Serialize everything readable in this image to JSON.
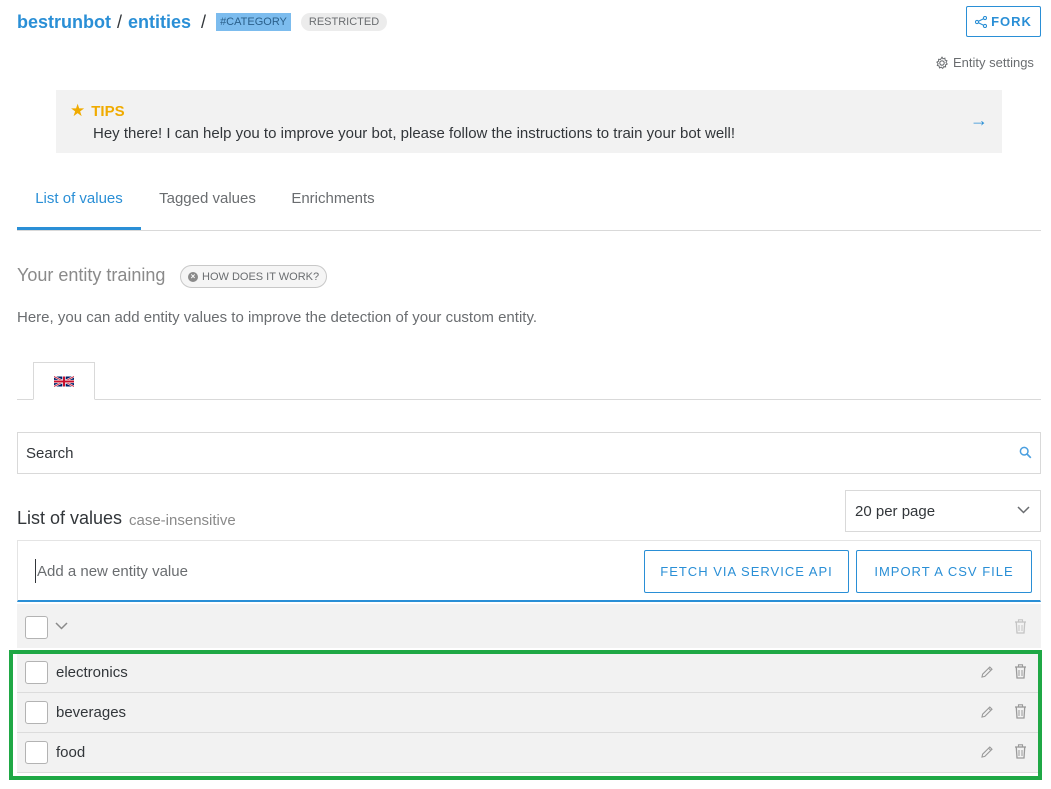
{
  "breadcrumb": {
    "bot": "bestrunbot",
    "separator": "/",
    "section": "entities",
    "separator2": "/",
    "category_tag": "#CATEGORY",
    "restricted_tag": "RESTRICTED"
  },
  "header": {
    "fork_label": "FORK",
    "entity_settings_label": "Entity settings"
  },
  "tips": {
    "title": "TIPS",
    "text": "Hey there! I can help you to improve your bot, please follow the instructions to train your bot well!",
    "arrow": "→"
  },
  "tabs": [
    {
      "label": "List of values",
      "active": true
    },
    {
      "label": "Tagged values",
      "active": false
    },
    {
      "label": "Enrichments",
      "active": false
    }
  ],
  "training": {
    "title": "Your entity training",
    "how_label": "HOW DOES IT WORK?",
    "description": "Here, you can add entity values to improve the detection of your custom entity."
  },
  "language_tab": {
    "flag": "UK flag",
    "active": true
  },
  "search": {
    "placeholder": "Search"
  },
  "list": {
    "title": "List of values",
    "subtitle": "case-insensitive",
    "per_page": "20 per page",
    "add_placeholder": "Add a new entity value",
    "fetch_label": "FETCH VIA SERVICE API",
    "import_label": "IMPORT A CSV FILE",
    "values": [
      "electronics",
      "beverages",
      "food"
    ]
  },
  "colors": {
    "accent": "#2a8fd6",
    "tips": "#f0ab00",
    "highlight": "#1fa845"
  }
}
